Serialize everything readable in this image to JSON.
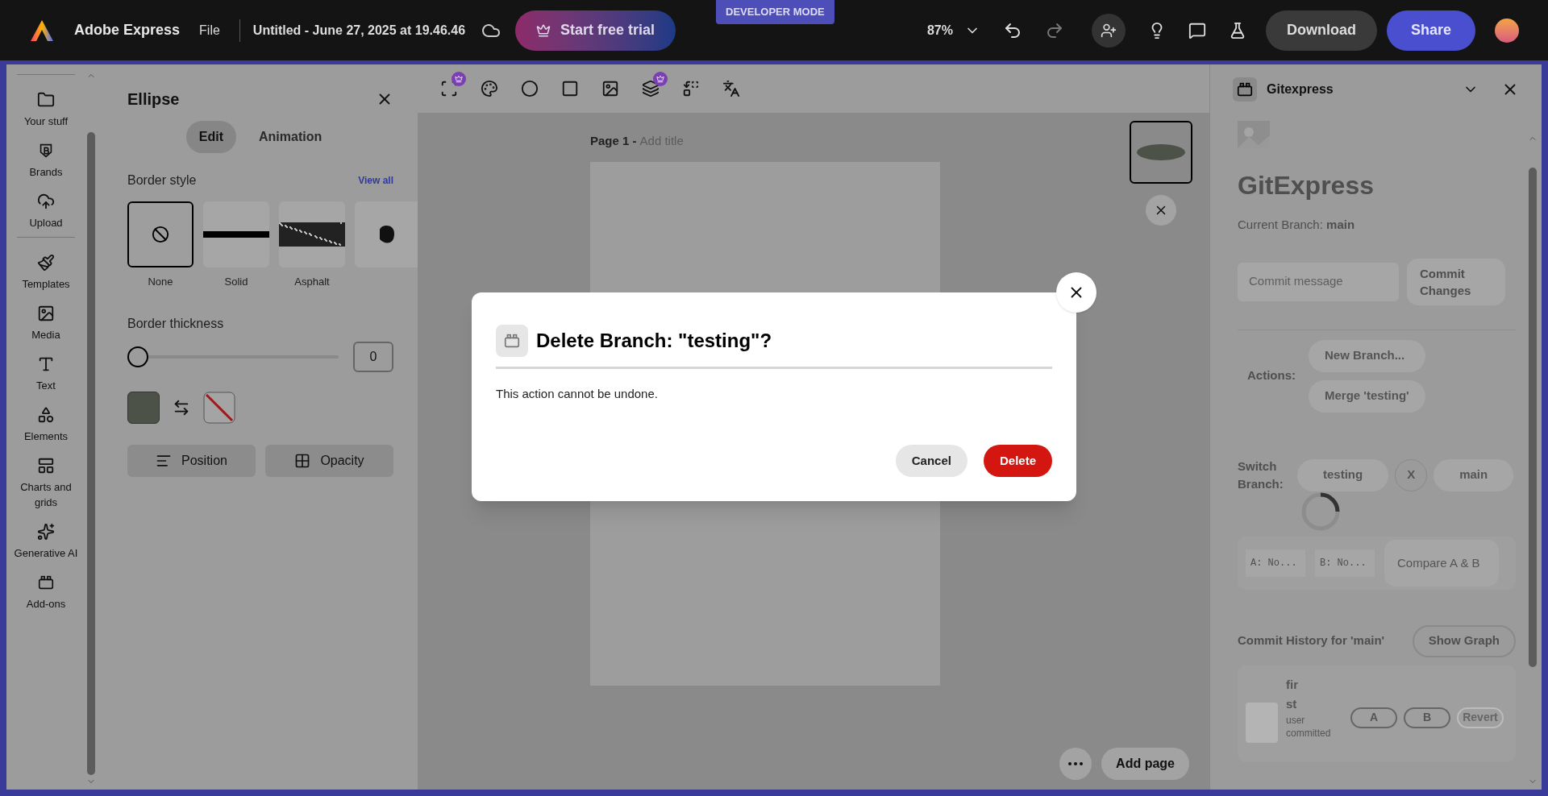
{
  "topbar": {
    "app_name": "Adobe Express",
    "file_menu": "File",
    "document_title": "Untitled - June 27, 2025 at 19.46.46",
    "trial_button": "Start free trial",
    "mode_badge": "DEVELOPER MODE",
    "zoom": "87%",
    "download_button": "Download",
    "share_button": "Share"
  },
  "rail": {
    "groups": [
      [
        {
          "label": "Your stuff"
        },
        {
          "label": "Brands"
        },
        {
          "label": "Upload"
        }
      ],
      [
        {
          "label": "Templates"
        },
        {
          "label": "Media"
        },
        {
          "label": "Text"
        },
        {
          "label": "Elements"
        },
        {
          "label": "Charts and grids"
        },
        {
          "label": "Generative AI"
        },
        {
          "label": "Add-ons"
        }
      ]
    ]
  },
  "panel": {
    "title": "Ellipse",
    "tabs": [
      {
        "label": "Edit",
        "selected": true
      },
      {
        "label": "Animation",
        "selected": false
      }
    ],
    "border_style": {
      "label": "Border style",
      "view_all": "View all",
      "styles": [
        {
          "kind": "none",
          "label": "None",
          "selected": true
        },
        {
          "kind": "solid",
          "label": "Solid",
          "selected": false
        },
        {
          "kind": "asphalt",
          "label": "Asphalt",
          "selected": false
        },
        {
          "kind": "blob",
          "selected": false
        }
      ]
    },
    "thickness": {
      "label": "Border thickness",
      "level": 0,
      "value": "0"
    },
    "fill": {
      "color": "#4d5249"
    },
    "stroke": {
      "kind": "none"
    },
    "buttons": [
      "Position",
      "Opacity"
    ]
  },
  "canvas": {
    "tools": [
      {
        "premium": true
      },
      {
        "premium": false
      },
      {
        "premium": false
      },
      {
        "premium": false
      },
      {
        "premium": false
      },
      {
        "premium": true
      },
      {
        "premium": false
      },
      {
        "premium": false
      }
    ],
    "page_label": "Page 1 -",
    "page_title_placeholder": "Add title",
    "add_page": "Add page"
  },
  "gitexpress": {
    "title": "Gitexpress",
    "loading": true,
    "heading": "GitExpress",
    "current_branch": "Current Branch: **main**",
    "commit_placeholder": "Commit message",
    "commit_button": "Commit Changes",
    "actions_label": "Actions:",
    "actions": [
      "New Branch...",
      "Merge 'testing'"
    ],
    "switch_label": "Switch Branch:",
    "branches": [
      "testing",
      "X",
      "main"
    ],
    "compare": {
      "a": "A:  No...",
      "b": "B:  No...",
      "button": "Compare A & B"
    },
    "history_label": "Commit History for 'main'",
    "graph_button": "Show Graph",
    "commits": [
      {
        "message": "first",
        "detail": "user committed",
        "buttons": [
          "A",
          "B",
          "Revert"
        ]
      }
    ]
  },
  "dialog": {
    "title": "Delete Branch: \"testing\"?",
    "body": "This action cannot be undone.",
    "cancel": "Cancel",
    "confirm": "Delete"
  }
}
